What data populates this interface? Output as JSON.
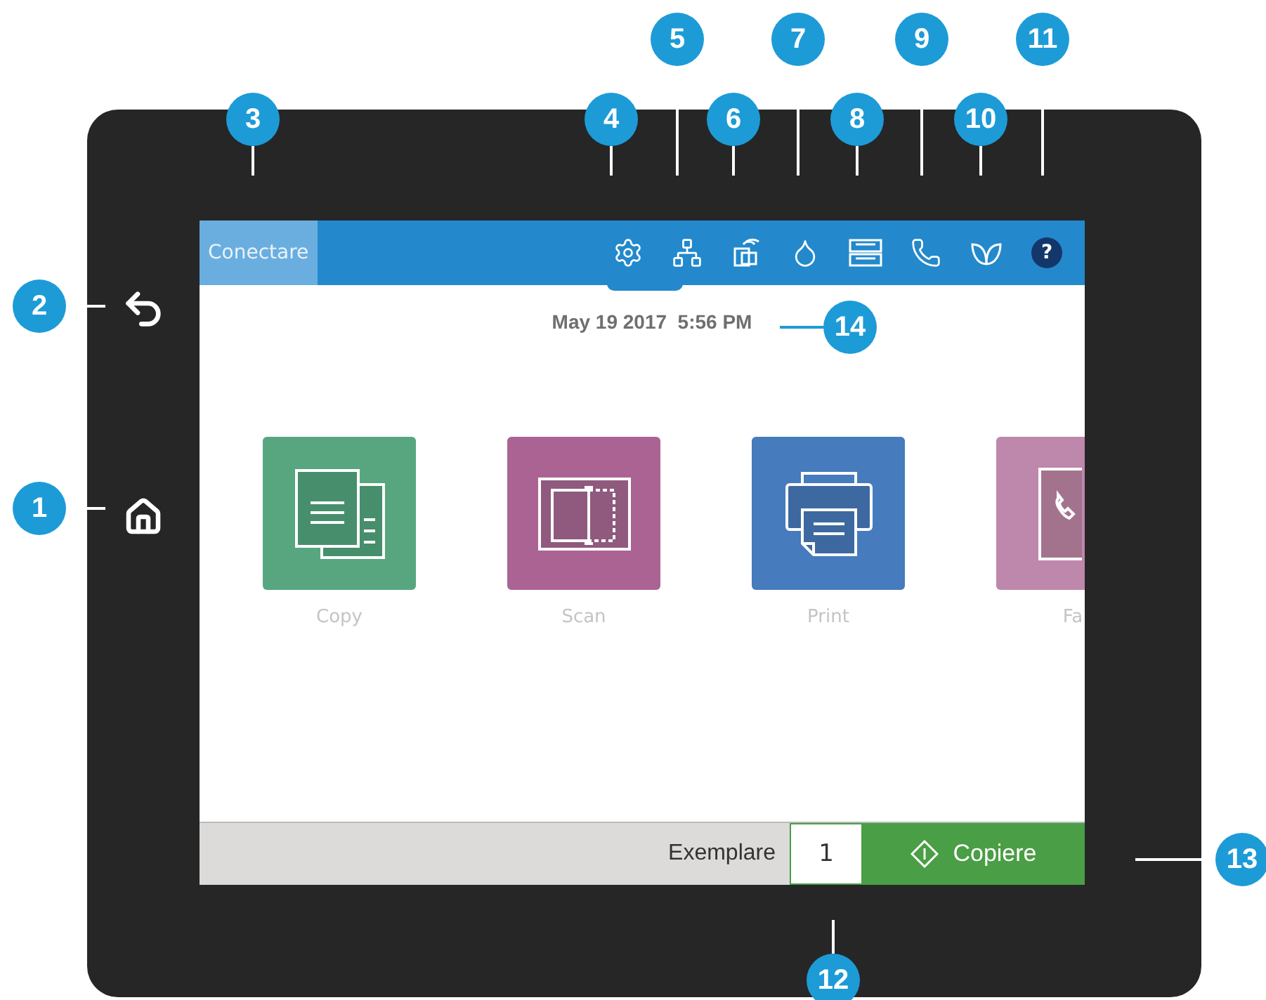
{
  "callouts": [
    "1",
    "2",
    "3",
    "4",
    "5",
    "6",
    "7",
    "8",
    "9",
    "10",
    "11",
    "12",
    "13",
    "14"
  ],
  "top_bar": {
    "tab": {
      "label": "Conectare",
      "selected": true
    },
    "help": "?"
  },
  "date_time": "May 19 2017  5:56 PM",
  "apps": [
    {
      "label": "Copy",
      "kind": "copy",
      "color": "#57a67f"
    },
    {
      "label": "Scan",
      "kind": "scan",
      "color": "#ab6394"
    },
    {
      "label": "Print",
      "kind": "print",
      "color": "#467bbd"
    },
    {
      "label": "Fa",
      "kind": "fax",
      "color": "#be87ac"
    }
  ],
  "bottom_bar": {
    "copies_label": "Exemplare",
    "copies_value": "1",
    "start_button": "Copiere"
  }
}
